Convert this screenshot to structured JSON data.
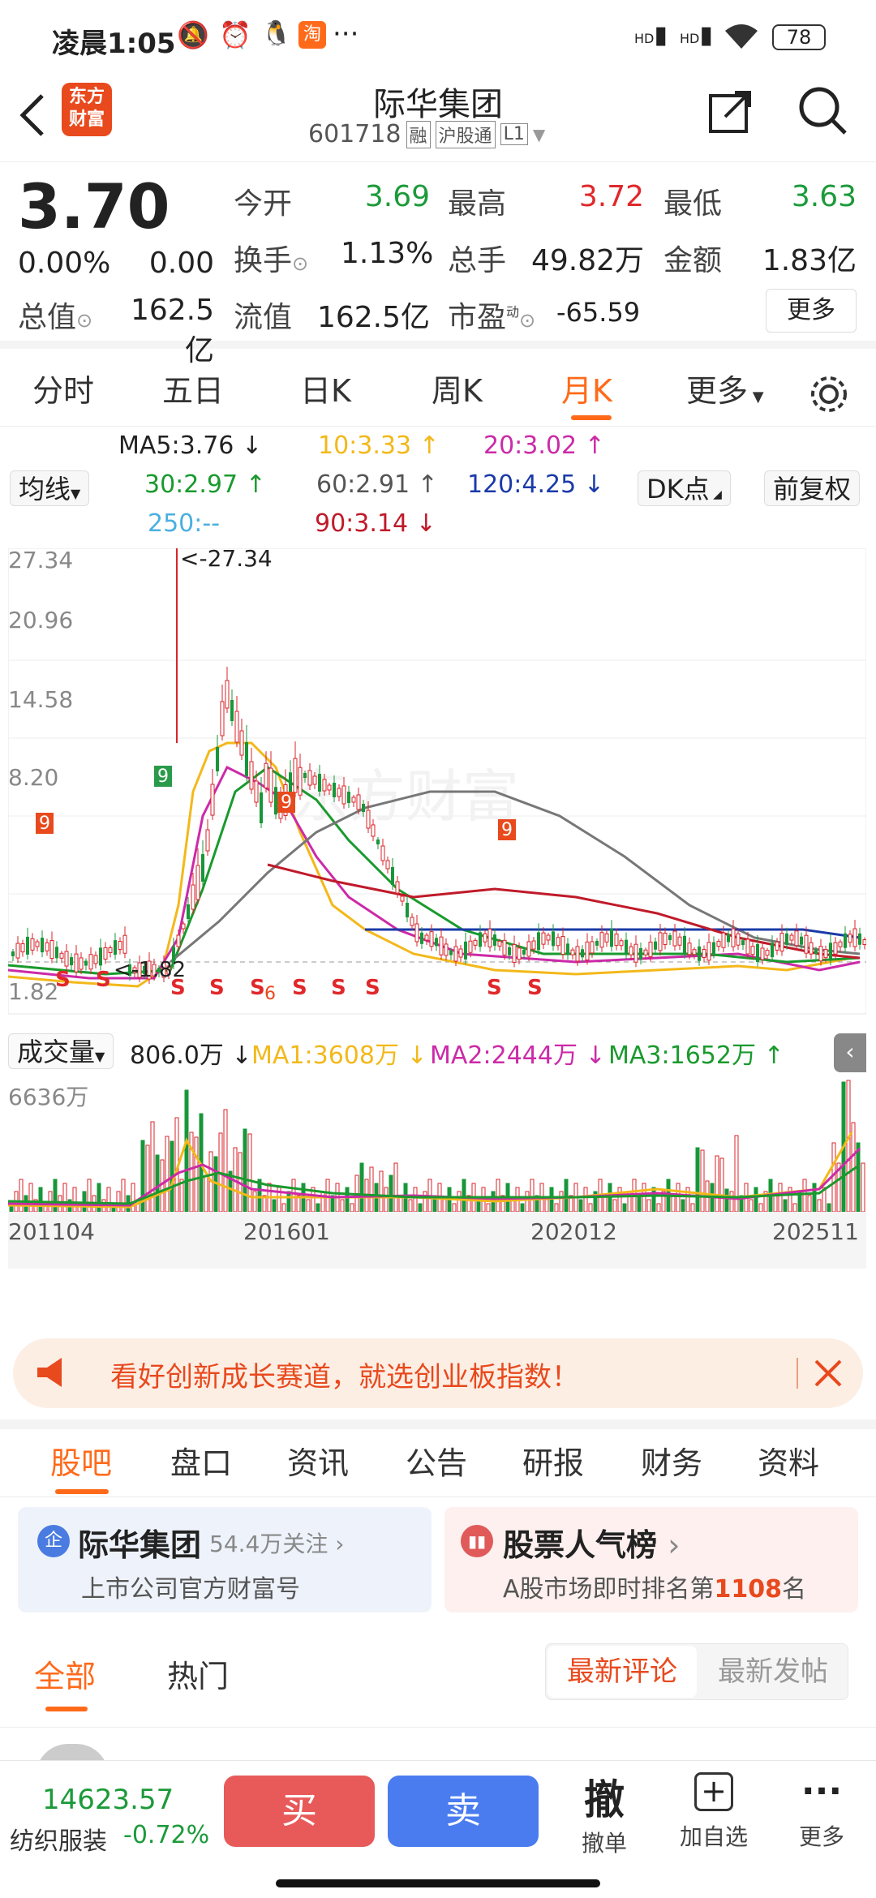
{
  "status_bar": {
    "time": "凌晨1:05",
    "battery": "78",
    "hd1": "HD",
    "hd2": "HD"
  },
  "header": {
    "logo": "东方\n财富",
    "title": "际华集团",
    "code": "601718",
    "tags": [
      "融",
      "沪股通",
      "L1"
    ]
  },
  "quote": {
    "price": "3.70",
    "change_pct": "0.00%",
    "change": "0.00",
    "open_label": "今开",
    "open": "3.69",
    "high_label": "最高",
    "high": "3.72",
    "low_label": "最低",
    "low": "3.63",
    "turnover_label": "换手",
    "turnover": "1.13%",
    "volume_label": "总手",
    "volume": "49.82万",
    "amount_label": "金额",
    "amount": "1.83亿",
    "mktcap_label": "总值",
    "mktcap": "162.5亿",
    "float_label": "流值",
    "float": "162.5亿",
    "pe_label": "市盈",
    "pe_sup": "动",
    "pe": "-65.59",
    "more": "更多"
  },
  "ktabs": [
    "分时",
    "五日",
    "日K",
    "周K",
    "月K",
    "更多"
  ],
  "ma": {
    "button": "均线",
    "ma5": "MA5:3.76",
    "ma10": "10:3.33",
    "ma20": "20:3.02",
    "ma30": "30:2.97",
    "ma60": "60:2.91",
    "ma120": "120:4.25",
    "ma250": "250:--",
    "ma90": "90:3.14",
    "dk": "DK点",
    "fq": "前复权",
    "c5": "#222222",
    "c10": "#f3b81a",
    "c20": "#cc2aa8",
    "c30": "#1a9a2e",
    "c60": "#666666",
    "c120": "#1a3aa8",
    "c250": "#4ab0e0",
    "c90": "#c01a2a"
  },
  "chart": {
    "y_ticks": [
      "27.34",
      "20.96",
      "14.58",
      "8.20",
      "1.82"
    ],
    "max_label": "<-27.34",
    "low_label": "1.82",
    "watermark": "东方财富",
    "vol_label": "成交量",
    "vol_value": "806.0万",
    "vma1": "MA1:3608万",
    "vma2": "MA2:2444万",
    "vma3": "MA3:1652万",
    "vol_max": "6636万",
    "x_ticks": [
      "201104",
      "201601",
      "202012",
      "202511"
    ],
    "td_marks": [
      "9",
      "9",
      "9",
      "9",
      "6"
    ]
  },
  "banner": {
    "text": "看好创新成长赛道，就选创业板指数！"
  },
  "subtabs": [
    "股吧",
    "盘口",
    "资讯",
    "公告",
    "研报",
    "财务",
    "资料"
  ],
  "card1": {
    "badge": "企",
    "name": "际华集团",
    "follows": "54.4万关注",
    "sub": "上市公司官方财富号"
  },
  "card2": {
    "name": "股票人气榜",
    "sub_prefix": "A股市场即时排名第",
    "rank": "1108",
    "sub_suffix": "名"
  },
  "feed_tabs": {
    "all": "全部",
    "hot": "热门",
    "latest_comment": "最新评论",
    "latest_post": "最新发帖"
  },
  "bottom": {
    "index_value": "14623.57",
    "index_name": "纺织服装",
    "index_change": "-0.72%",
    "buy": "买",
    "sell": "卖",
    "cancel_icon": "撤",
    "cancel": "撤单",
    "add": "加自选",
    "more": "更多"
  }
}
